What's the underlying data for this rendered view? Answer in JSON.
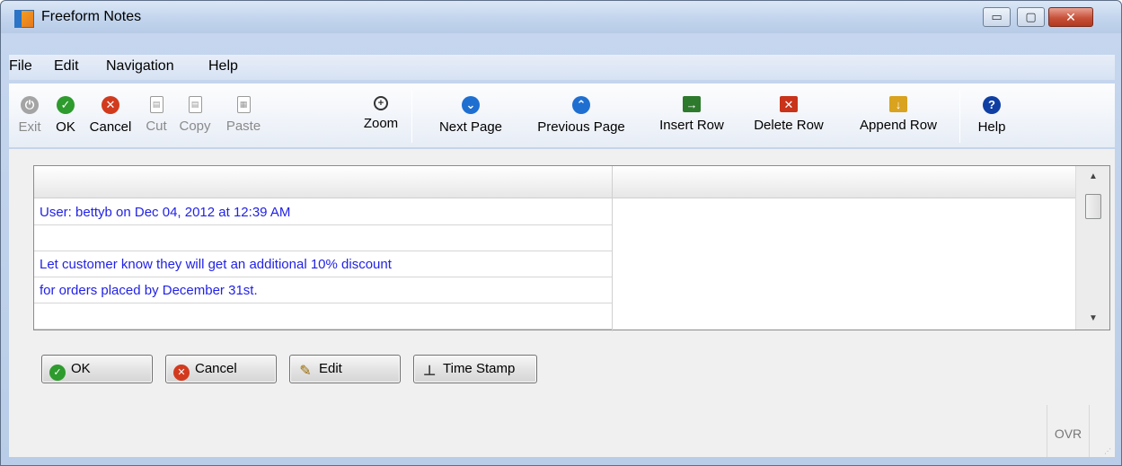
{
  "window": {
    "title": "Freeform Notes",
    "minimize_glyph": "▭",
    "maximize_glyph": "▢",
    "close_glyph": "✕"
  },
  "menu": [
    "File",
    "Edit",
    "Navigation",
    "Help"
  ],
  "toolbar": {
    "items": [
      {
        "label": "Exit",
        "icon": "power-icon",
        "enabled": false
      },
      {
        "label": "OK",
        "icon": "check-icon",
        "enabled": true
      },
      {
        "label": "Cancel",
        "icon": "cancel-x-icon",
        "enabled": true
      },
      {
        "label": "Cut",
        "icon": "cut-icon",
        "enabled": false
      },
      {
        "label": "Copy",
        "icon": "copy-icon",
        "enabled": false
      },
      {
        "label": "Paste",
        "icon": "paste-icon",
        "enabled": false
      },
      {
        "label": "Zoom",
        "icon": "zoom-icon",
        "enabled": true
      },
      {
        "label": "Next Page",
        "icon": "chevron-down-icon",
        "enabled": true
      },
      {
        "label": "Previous Page",
        "icon": "chevron-up-icon",
        "enabled": true
      },
      {
        "label": "Insert Row",
        "icon": "insert-row-icon",
        "enabled": true
      },
      {
        "label": "Delete Row",
        "icon": "delete-row-icon",
        "enabled": true
      },
      {
        "label": "Append Row",
        "icon": "append-row-icon",
        "enabled": true
      },
      {
        "label": "Help",
        "icon": "help-icon",
        "enabled": true
      }
    ]
  },
  "notes": {
    "rows": [
      "User: bettyb on Dec 04, 2012 at 12:39 AM",
      "",
      "Let customer know they will get an additional 10% discount",
      "for orders placed by December 31st.",
      ""
    ],
    "text_color": "#2222e6"
  },
  "buttons": {
    "ok": "OK",
    "cancel": "Cancel",
    "edit": "Edit",
    "time_stamp": "Time Stamp"
  },
  "status": {
    "mode": "OVR"
  }
}
